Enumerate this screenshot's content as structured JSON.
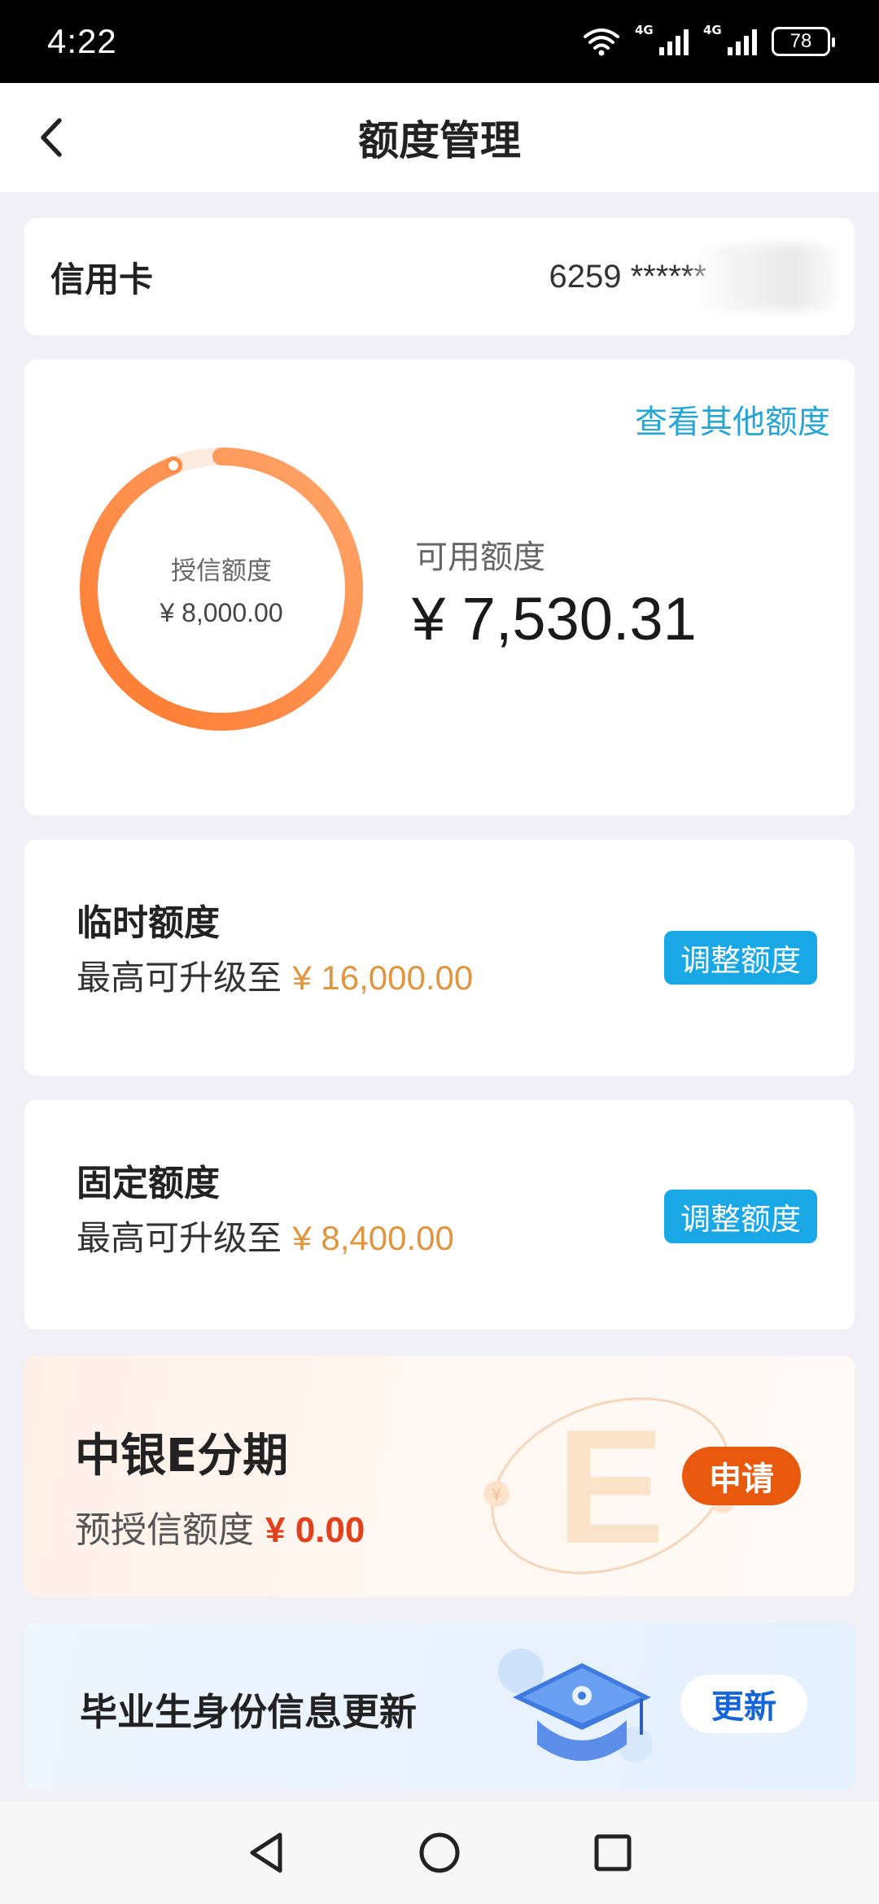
{
  "status_bar": {
    "time": "4:22",
    "battery": "78",
    "network_1": "4G",
    "network_2": "4G"
  },
  "header": {
    "title": "额度管理",
    "back_icon": "chevron-left-icon"
  },
  "account": {
    "label": "信用卡",
    "number_masked": "6259 ******"
  },
  "quota": {
    "view_other_link": "查看其他额度",
    "credit_limit_label": "授信额度",
    "credit_limit_value": "¥ 8,000.00",
    "available_label": "可用额度",
    "available_value": "¥ 7,530.31",
    "available_fraction": 0.941
  },
  "temporary_quota": {
    "title": "临时额度",
    "sub_prefix": "最高可升级至 ",
    "sub_amount": "¥ 16,000.00",
    "button_label": "调整额度"
  },
  "fixed_quota": {
    "title": "固定额度",
    "sub_prefix": "最高可升级至 ",
    "sub_amount": "¥ 8,400.00",
    "button_label": "调整额度"
  },
  "installment": {
    "title": "中银E分期",
    "sub_prefix": "预授信额度 ",
    "sub_amount": "¥ 0.00",
    "button_label": "申请"
  },
  "graduate": {
    "title": "毕业生身份信息更新",
    "button_label": "更新"
  },
  "colors": {
    "accent_blue": "#1aa7e6",
    "link_blue": "#27a6d6",
    "ring_orange": "#ff7a2f",
    "amount_orange": "#e0953f",
    "apply_orange": "#e8590e",
    "amount_red": "#e2411e",
    "update_blue": "#1565d8"
  }
}
